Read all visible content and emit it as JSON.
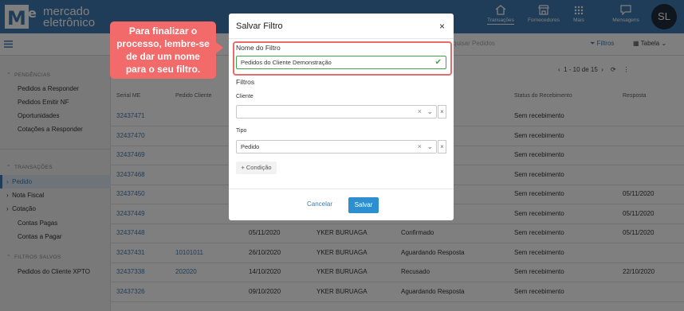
{
  "brand": {
    "line1": "mercado",
    "line2": "eletrônico",
    "accent": "#3f7ab3"
  },
  "nav": [
    {
      "label": "Transações",
      "icon": "home-icon"
    },
    {
      "label": "Fornecedores",
      "icon": "store-icon"
    },
    {
      "label": "Mais",
      "icon": "grid-icon"
    },
    {
      "label": "Mensagens",
      "icon": "message-icon"
    }
  ],
  "user": {
    "initials": "SL"
  },
  "toolbar": {
    "search_placeholder": "quisar Pedidos",
    "filters_label": "Filtros",
    "table_label": "Tabela"
  },
  "sidebar": {
    "sec_pendencias": "PENDÊNCIAS",
    "pend_items": [
      "Pedidos a Responder",
      "Pedidos Emitir NF",
      "Oportunidades",
      "Cotações a Responder"
    ],
    "sec_transacoes": "TRANSAÇÕES",
    "trans_items": [
      "Pedido",
      "Nota Fiscal",
      "Cotação",
      "Contas Pagas",
      "Contas a Pagar"
    ],
    "sec_filtros": "FILTROS SALVOS",
    "filtro_items": [
      "Pedidos do Cliente XPTO"
    ]
  },
  "pager": {
    "text": "1 - 10 de 15"
  },
  "table": {
    "headers": [
      "Serial ME",
      "Pedido Cliente",
      "Status do Recebimento",
      "Resposta"
    ],
    "rows": [
      {
        "serial": "32437471",
        "pedido": "",
        "data": "",
        "fornecedor": "",
        "status": "esposta",
        "recebimento": "Sem recebimento",
        "resposta": ""
      },
      {
        "serial": "32437470",
        "pedido": "",
        "data": "",
        "fornecedor": "",
        "status": "esposta",
        "recebimento": "Sem recebimento",
        "resposta": ""
      },
      {
        "serial": "32437469",
        "pedido": "",
        "data": "",
        "fornecedor": "",
        "status": "esposta",
        "recebimento": "Sem recebimento",
        "resposta": ""
      },
      {
        "serial": "32437468",
        "pedido": "",
        "data": "",
        "fornecedor": "",
        "status": "esposta",
        "recebimento": "Sem recebimento",
        "resposta": ""
      },
      {
        "serial": "32437450",
        "pedido": "",
        "data": "",
        "fornecedor": "",
        "status": "",
        "recebimento": "Sem recebimento",
        "resposta": "05/11/2020"
      },
      {
        "serial": "32437449",
        "pedido": "",
        "data": "",
        "fornecedor": "",
        "status": "",
        "recebimento": "Sem recebimento",
        "resposta": "05/11/2020"
      },
      {
        "serial": "32437448",
        "pedido": "",
        "data": "05/11/2020",
        "fornecedor": "YKER BURUAGA",
        "status": "Confirmado",
        "recebimento": "Sem recebimento",
        "resposta": "05/11/2020"
      },
      {
        "serial": "32437431",
        "pedido": "10101011",
        "data": "26/10/2020",
        "fornecedor": "YKER BURUAGA",
        "status": "Aguardando Resposta",
        "recebimento": "Sem recebimento",
        "resposta": ""
      },
      {
        "serial": "32437338",
        "pedido": "202020",
        "data": "14/10/2020",
        "fornecedor": "YKER BURUAGA",
        "status": "Recusado",
        "recebimento": "Sem recebimento",
        "resposta": "22/10/2020"
      },
      {
        "serial": "32437326",
        "pedido": "",
        "data": "09/10/2020",
        "fornecedor": "YKER BURUAGA",
        "status": "Aguardando Resposta",
        "recebimento": "Sem recebimento",
        "resposta": ""
      }
    ]
  },
  "tooltip": {
    "lines": [
      "Para finalizar o",
      "processo, lembre-se",
      "de dar um nome",
      "para o seu filtro."
    ],
    "color": "#f26a6a"
  },
  "modal": {
    "title": "Salvar Filtro",
    "close": "×",
    "name_label": "Nome do Filtro",
    "name_value": "Pedidos do Cliente Demonstração",
    "filters_label": "Filtros",
    "cliente_label": "Cliente",
    "cliente_value": "",
    "tipo_label": "Tipo",
    "tipo_value": "Pedido",
    "add_condition": "+ Condição",
    "cancel": "Cancelar",
    "save": "Salvar",
    "save_color": "#2d8fd0"
  }
}
